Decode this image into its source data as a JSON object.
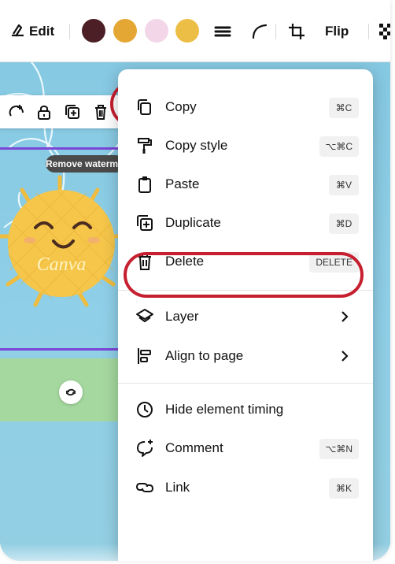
{
  "toolbar": {
    "edit_label": "Edit",
    "flip_label": "Flip",
    "swatches": [
      "#4b1f25",
      "#e5a733",
      "#f3d6e7",
      "#edbe45"
    ],
    "icons": [
      "edit-icon",
      "line-style-icon",
      "corner-icon",
      "crop-icon",
      "transparency-icon"
    ]
  },
  "canvas": {
    "watermark_badge": "Remove watermark",
    "watermark_text": "Canva",
    "element_toolbar_icons": [
      "replace-icon",
      "lock-icon",
      "duplicate-icon",
      "trash-icon",
      "more-icon"
    ],
    "rotate_icon": "rotate-icon",
    "colors": {
      "background": "#86c9e2",
      "sun": "#f5c649",
      "sun_stroke": "#f4b93f",
      "selection": "#7b45d8",
      "annotation": "#c61f2f"
    }
  },
  "context_menu": {
    "items": [
      {
        "label": "Copy",
        "shortcut": "⌘C",
        "icon": "copy-icon"
      },
      {
        "label": "Copy style",
        "shortcut": "⌥⌘C",
        "icon": "paint-roller-icon"
      },
      {
        "label": "Paste",
        "shortcut": "⌘V",
        "icon": "clipboard-icon"
      },
      {
        "label": "Duplicate",
        "shortcut": "⌘D",
        "icon": "duplicate-icon"
      },
      {
        "label": "Delete",
        "shortcut": "DELETE",
        "icon": "trash-icon"
      },
      {
        "label": "Layer",
        "shortcut": "",
        "icon": "layers-icon"
      },
      {
        "label": "Align to page",
        "shortcut": "",
        "icon": "align-icon"
      },
      {
        "label": "Hide element timing",
        "shortcut": "",
        "icon": "clock-icon"
      },
      {
        "label": "Comment",
        "shortcut": "⌥⌘N",
        "icon": "comment-icon"
      },
      {
        "label": "Link",
        "shortcut": "⌘K",
        "icon": "link-icon"
      }
    ]
  }
}
